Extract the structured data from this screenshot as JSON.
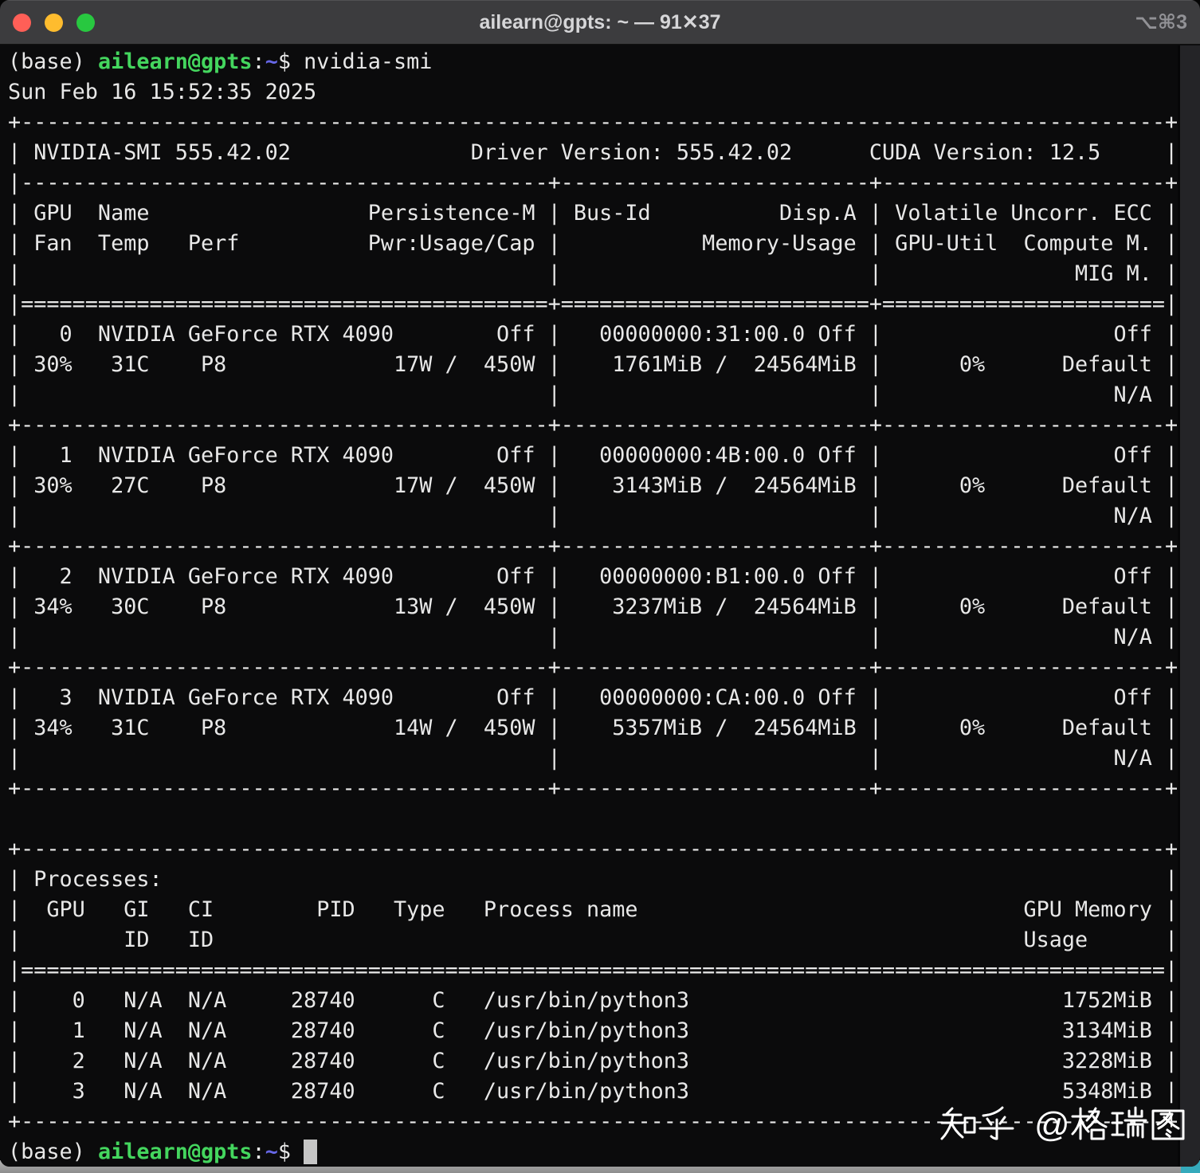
{
  "window": {
    "title": "ailearn@gpts: ~ — 91✕37",
    "shortcut": "⌥⌘3"
  },
  "colors": {
    "terminal_background": "#0b0b0c",
    "terminal_foreground": "#e8e8e8",
    "prompt_user_green": "#44d65e",
    "prompt_path_blue": "#6767e6",
    "titlebar": "#3c3c3e",
    "traffic_red": "#ff5f57",
    "traffic_yellow": "#febc2e",
    "traffic_green": "#28c840",
    "cursor": "#c6c6c6"
  },
  "terminal": {
    "prompt": {
      "venv": "(base) ",
      "userhost": "ailearn@gpts",
      "sep": ":",
      "cwd": "~",
      "symbol": "$ "
    },
    "command": "nvidia-smi",
    "datetime": "Sun Feb 16 15:52:35 2025",
    "smi_lines": [
      "+-----------------------------------------------------------------------------------------+",
      "| NVIDIA-SMI 555.42.02              Driver Version: 555.42.02      CUDA Version: 12.5     |",
      "|-----------------------------------------+------------------------+----------------------+",
      "| GPU  Name                 Persistence-M | Bus-Id          Disp.A | Volatile Uncorr. ECC |",
      "| Fan  Temp   Perf          Pwr:Usage/Cap |           Memory-Usage | GPU-Util  Compute M. |",
      "|                                         |                        |               MIG M. |",
      "|=========================================+========================+======================|",
      "|   0  NVIDIA GeForce RTX 4090        Off |   00000000:31:00.0 Off |                  Off |",
      "| 30%   31C    P8             17W /  450W |    1761MiB /  24564MiB |      0%      Default |",
      "|                                         |                        |                  N/A |",
      "+-----------------------------------------+------------------------+----------------------+",
      "|   1  NVIDIA GeForce RTX 4090        Off |   00000000:4B:00.0 Off |                  Off |",
      "| 30%   27C    P8             17W /  450W |    3143MiB /  24564MiB |      0%      Default |",
      "|                                         |                        |                  N/A |",
      "+-----------------------------------------+------------------------+----------------------+",
      "|   2  NVIDIA GeForce RTX 4090        Off |   00000000:B1:00.0 Off |                  Off |",
      "| 34%   30C    P8             13W /  450W |    3237MiB /  24564MiB |      0%      Default |",
      "|                                         |                        |                  N/A |",
      "+-----------------------------------------+------------------------+----------------------+",
      "|   3  NVIDIA GeForce RTX 4090        Off |   00000000:CA:00.0 Off |                  Off |",
      "| 34%   31C    P8             14W /  450W |    5357MiB /  24564MiB |      0%      Default |",
      "|                                         |                        |                  N/A |",
      "+-----------------------------------------+------------------------+----------------------+",
      "",
      "+-----------------------------------------------------------------------------------------+",
      "| Processes:                                                                              |",
      "|  GPU   GI   CI        PID   Type   Process name                              GPU Memory |",
      "|        ID   ID                                                               Usage      |",
      "|=========================================================================================|",
      "|    0   N/A  N/A     28740      C   /usr/bin/python3                             1752MiB |",
      "|    1   N/A  N/A     28740      C   /usr/bin/python3                             3134MiB |",
      "|    2   N/A  N/A     28740      C   /usr/bin/python3                             3228MiB |",
      "|    3   N/A  N/A     28740      C   /usr/bin/python3                             5348MiB |",
      "+-----------------------------------------------------------------------------------------+"
    ],
    "gpu_table": {
      "driver_version": "555.42.02",
      "cuda_version": "12.5",
      "nvidia_smi_version": "555.42.02",
      "gpus": [
        {
          "id": 0,
          "name": "NVIDIA GeForce RTX 4090",
          "persistence": "Off",
          "bus_id": "00000000:31:00.0",
          "disp_a": "Off",
          "ecc": "Off",
          "fan": "30%",
          "temp": "31C",
          "perf": "P8",
          "power": "17W /  450W",
          "memory": "1761MiB /  24564MiB",
          "util": "0%",
          "compute_mode": "Default",
          "mig": "N/A"
        },
        {
          "id": 1,
          "name": "NVIDIA GeForce RTX 4090",
          "persistence": "Off",
          "bus_id": "00000000:4B:00.0",
          "disp_a": "Off",
          "ecc": "Off",
          "fan": "30%",
          "temp": "27C",
          "perf": "P8",
          "power": "17W /  450W",
          "memory": "3143MiB /  24564MiB",
          "util": "0%",
          "compute_mode": "Default",
          "mig": "N/A"
        },
        {
          "id": 2,
          "name": "NVIDIA GeForce RTX 4090",
          "persistence": "Off",
          "bus_id": "00000000:B1:00.0",
          "disp_a": "Off",
          "ecc": "Off",
          "fan": "34%",
          "temp": "30C",
          "perf": "P8",
          "power": "13W /  450W",
          "memory": "3237MiB /  24564MiB",
          "util": "0%",
          "compute_mode": "Default",
          "mig": "N/A"
        },
        {
          "id": 3,
          "name": "NVIDIA GeForce RTX 4090",
          "persistence": "Off",
          "bus_id": "00000000:CA:00.0",
          "disp_a": "Off",
          "ecc": "Off",
          "fan": "34%",
          "temp": "31C",
          "perf": "P8",
          "power": "14W /  450W",
          "memory": "5357MiB /  24564MiB",
          "util": "0%",
          "compute_mode": "Default",
          "mig": "N/A"
        }
      ],
      "processes": [
        {
          "gpu": 0,
          "gi_id": "N/A",
          "ci_id": "N/A",
          "pid": 28740,
          "type": "C",
          "name": "/usr/bin/python3",
          "gpu_memory": "1752MiB"
        },
        {
          "gpu": 1,
          "gi_id": "N/A",
          "ci_id": "N/A",
          "pid": 28740,
          "type": "C",
          "name": "/usr/bin/python3",
          "gpu_memory": "3134MiB"
        },
        {
          "gpu": 2,
          "gi_id": "N/A",
          "ci_id": "N/A",
          "pid": 28740,
          "type": "C",
          "name": "/usr/bin/python3",
          "gpu_memory": "3228MiB"
        },
        {
          "gpu": 3,
          "gi_id": "N/A",
          "ci_id": "N/A",
          "pid": 28740,
          "type": "C",
          "name": "/usr/bin/python3",
          "gpu_memory": "5348MiB"
        }
      ]
    }
  },
  "watermark": "知乎 @格瑞图"
}
